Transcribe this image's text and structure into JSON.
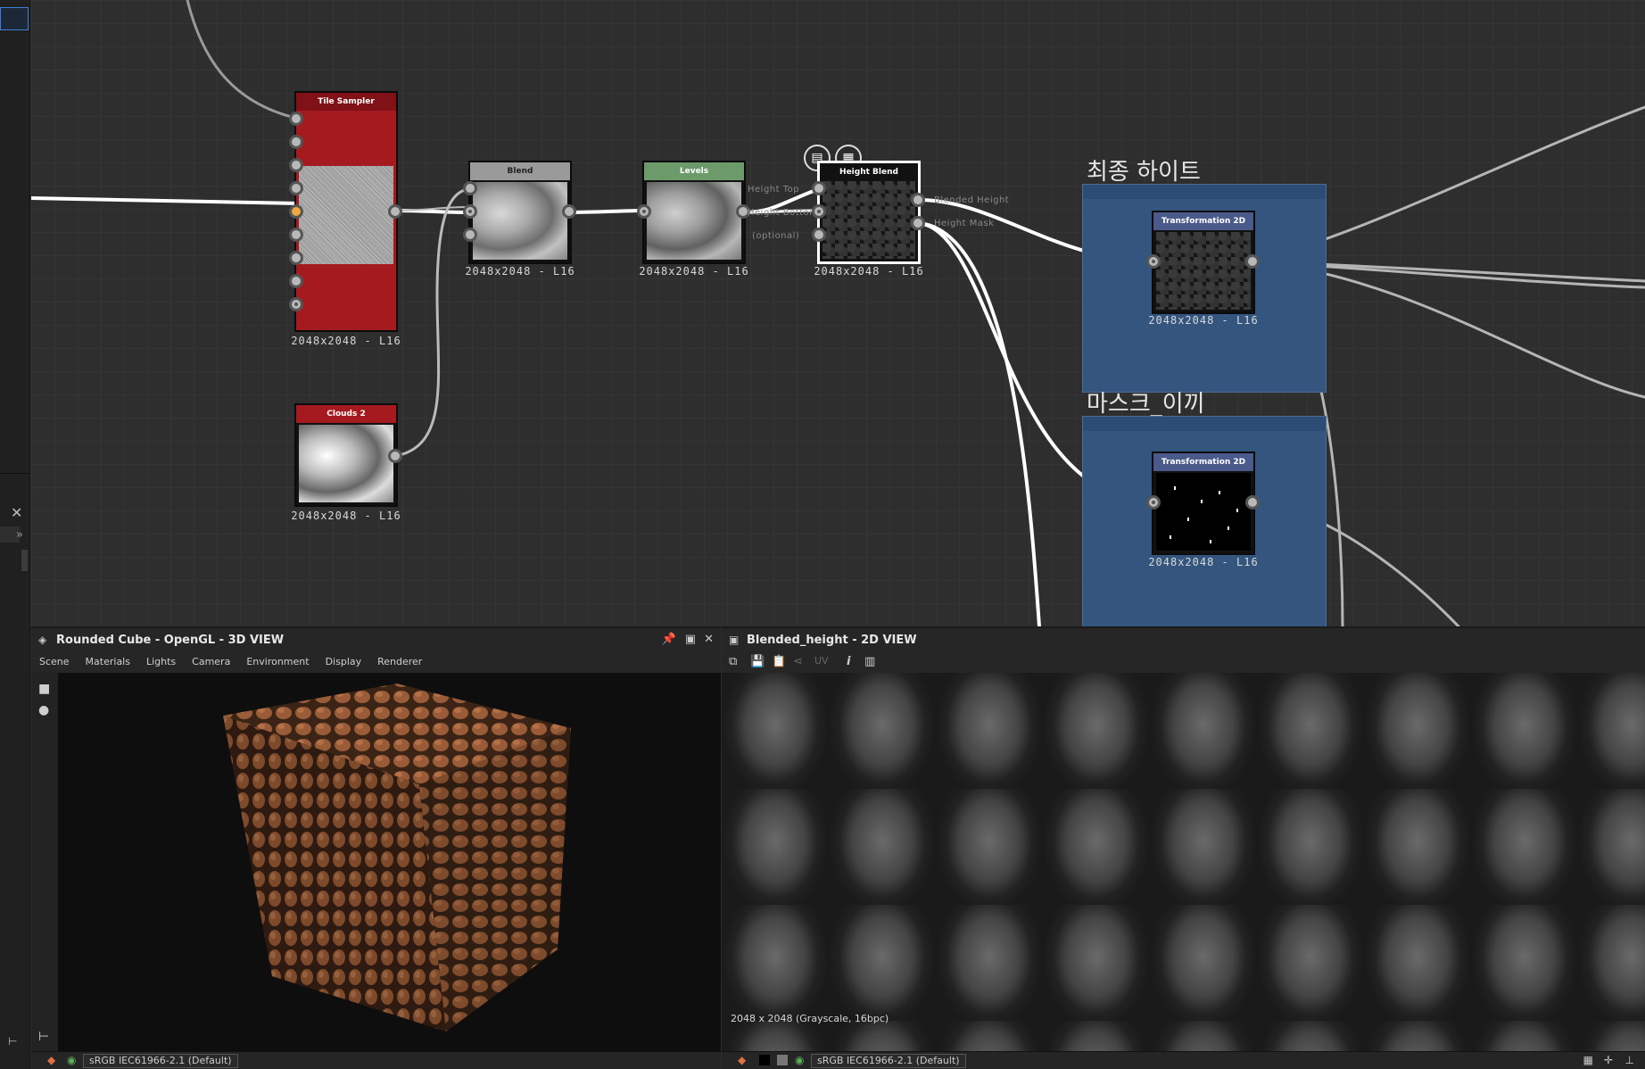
{
  "app": {
    "frames": [
      {
        "title": "최종 하이트"
      },
      {
        "title": "마스크_이끼"
      }
    ]
  },
  "nodes": {
    "tile_sampler": {
      "title": "Tile Sampler",
      "caption": "2048x2048 - L16",
      "header_color": "#a51a1f"
    },
    "clouds2": {
      "title": "Clouds 2",
      "caption": "2048x2048 - L16",
      "header_color": "#a51a1f"
    },
    "blend": {
      "title": "Blend",
      "caption": "2048x2048 - L16",
      "header_color": "#9a9a9a"
    },
    "levels": {
      "title": "Levels",
      "caption": "2048x2048 - L16",
      "header_color": "#6d9a6a"
    },
    "height_blend": {
      "title": "Height Blend",
      "caption": "2048x2048 - L16",
      "inputs": [
        "Height Top",
        "Height Bottom",
        "(optional)"
      ],
      "outputs": [
        "Blended Height",
        "Height Mask"
      ]
    },
    "transform_a": {
      "title": "Transformation 2D",
      "caption": "2048x2048 - L16",
      "header_color": "#4a5a8a"
    },
    "transform_b": {
      "title": "Transformation 2D",
      "caption": "2048x2048 - L16",
      "header_color": "#4a5a8a"
    }
  },
  "panel3d": {
    "title": "Rounded Cube - OpenGL - 3D VIEW",
    "menu": [
      "Scene",
      "Materials",
      "Lights",
      "Camera",
      "Environment",
      "Display",
      "Renderer"
    ],
    "colorspace": "sRGB IEC61966-2.1 (Default)"
  },
  "panel2d": {
    "title": "Blended_height - 2D VIEW",
    "uv_label": "UV",
    "info": "2048 x 2048 (Grayscale, 16bpc)",
    "colorspace": "sRGB IEC61966-2.1 (Default)"
  },
  "icons": {
    "pin": "pin-icon",
    "window": "window-icon",
    "close": "close-icon"
  }
}
